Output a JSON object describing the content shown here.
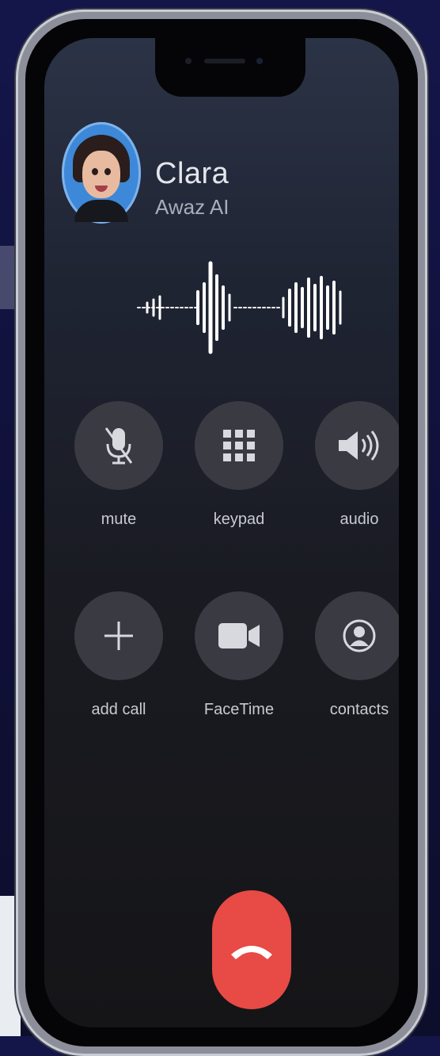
{
  "caller": {
    "name": "Clara",
    "subtitle": "Awaz AI",
    "avatar_icon": "memoji-avatar-icon"
  },
  "controls": [
    {
      "label": "mute",
      "icon": "mic-muted-icon"
    },
    {
      "label": "keypad",
      "icon": "keypad-icon"
    },
    {
      "label": "audio",
      "icon": "speaker-icon"
    },
    {
      "label": "add call",
      "icon": "plus-icon"
    },
    {
      "label": "FaceTime",
      "icon": "video-camera-icon"
    },
    {
      "label": "contacts",
      "icon": "contact-icon"
    }
  ],
  "end_call": {
    "icon": "hang-up-icon",
    "color": "#e84a45"
  },
  "theme": {
    "background": "#14164a",
    "button_fill": "#3a3b42",
    "text": "#e4e6ec"
  }
}
